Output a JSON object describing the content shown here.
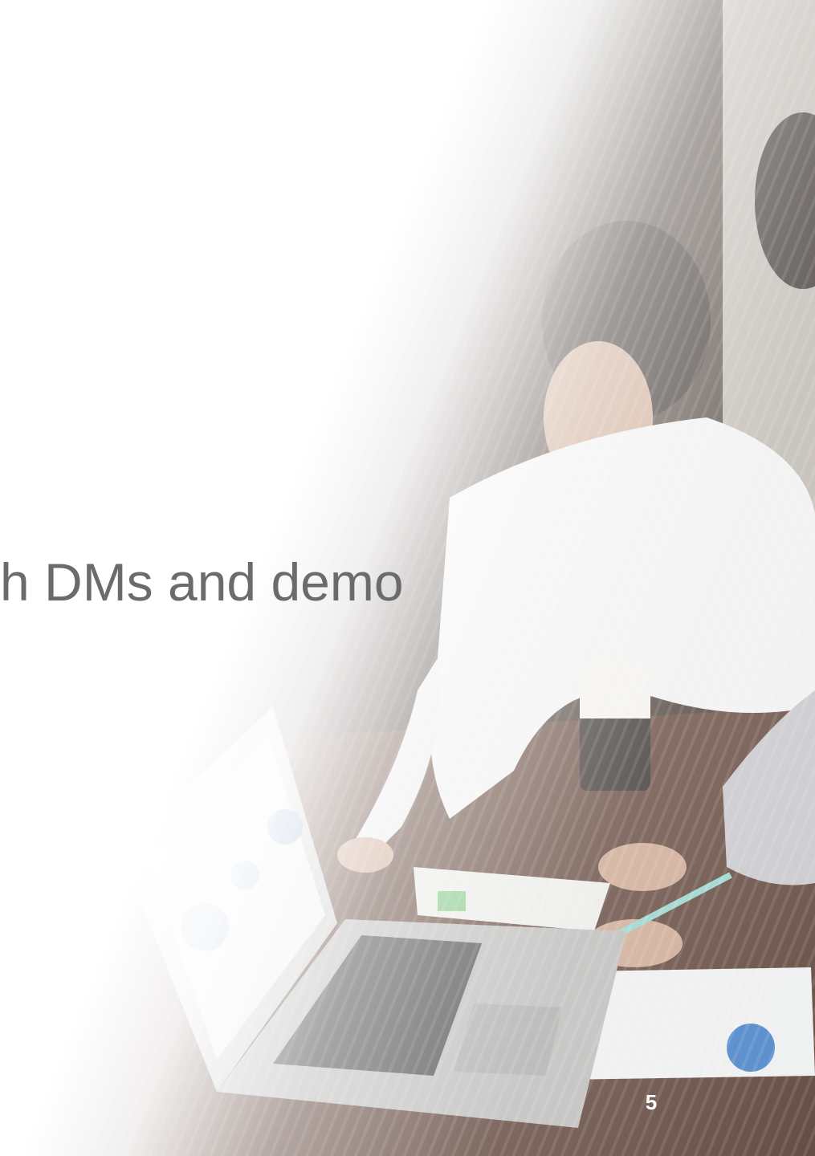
{
  "slide": {
    "headline": "h DMs and demo",
    "page_number": "5"
  },
  "colors": {
    "headline_text": "#6b6b6b",
    "page_number_text": "#ffffff",
    "background": "#ffffff"
  },
  "background_image": {
    "icon": "office-meeting-photo"
  }
}
